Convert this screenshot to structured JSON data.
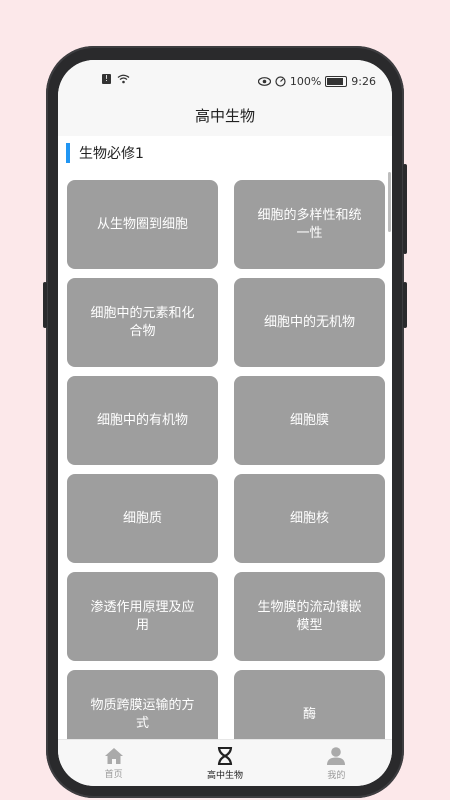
{
  "status_bar": {
    "battery_pct": "100%",
    "time": "9:26"
  },
  "header": {
    "title": "高中生物"
  },
  "section": {
    "title": "生物必修1"
  },
  "cards": [
    "从生物圈到细胞",
    "细胞的多样性和统一性",
    "细胞中的元素和化合物",
    "细胞中的无机物",
    "细胞中的有机物",
    "细胞膜",
    "细胞质",
    "细胞核",
    "渗透作用原理及应用",
    "生物膜的流动镶嵌模型",
    "物质跨膜运输的方式",
    "酶"
  ],
  "tabbar": {
    "home": "首页",
    "biology": "高中生物",
    "mine": "我的"
  },
  "colors": {
    "card_bg": "#9e9e9e",
    "accent": "#2196f3",
    "page_bg": "#fce8ea"
  },
  "icons": {
    "home": "home-icon",
    "biology": "dna-icon",
    "mine": "user-icon"
  }
}
